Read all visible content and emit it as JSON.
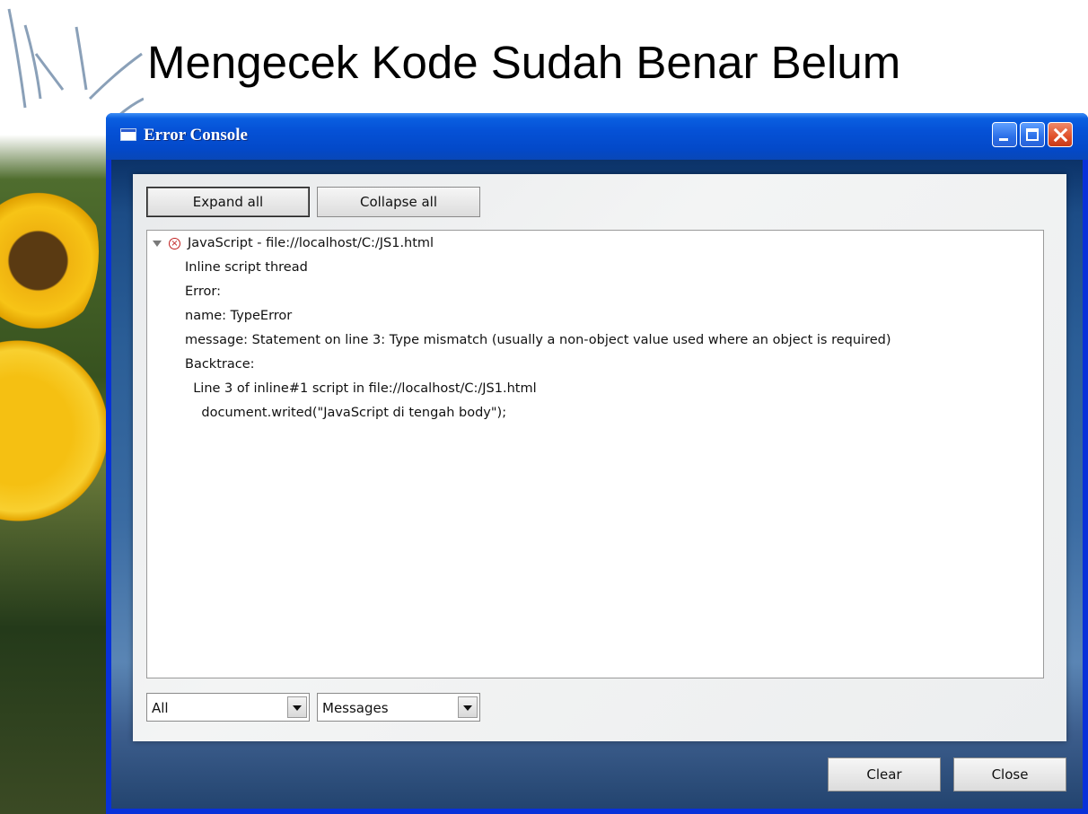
{
  "slide": {
    "title": "Mengecek Kode Sudah Benar Belum"
  },
  "window": {
    "title": "Error Console",
    "controls": {
      "minimize_icon": "minimize-icon",
      "maximize_icon": "maximize-icon",
      "close_icon": "close-icon"
    }
  },
  "toolbar": {
    "expand_label": "Expand all",
    "collapse_label": "Collapse all"
  },
  "console": {
    "entry_header": "JavaScript - file://localhost/C:/JS1.html",
    "lines": [
      "Inline script thread",
      "Error:",
      "name: TypeError",
      "message: Statement on line 3: Type mismatch (usually a non-object value used where an object is required)",
      "Backtrace:",
      "  Line 3 of inline#1 script in file://localhost/C:/JS1.html",
      "    document.writed(\"JavaScript di tengah body\");"
    ]
  },
  "filters": {
    "source_selected": "All",
    "type_selected": "Messages"
  },
  "footer": {
    "clear_label": "Clear",
    "close_label": "Close"
  },
  "colors": {
    "titlebar": "#0551d6",
    "close_button": "#e0502a",
    "error_icon": "#c02020"
  }
}
